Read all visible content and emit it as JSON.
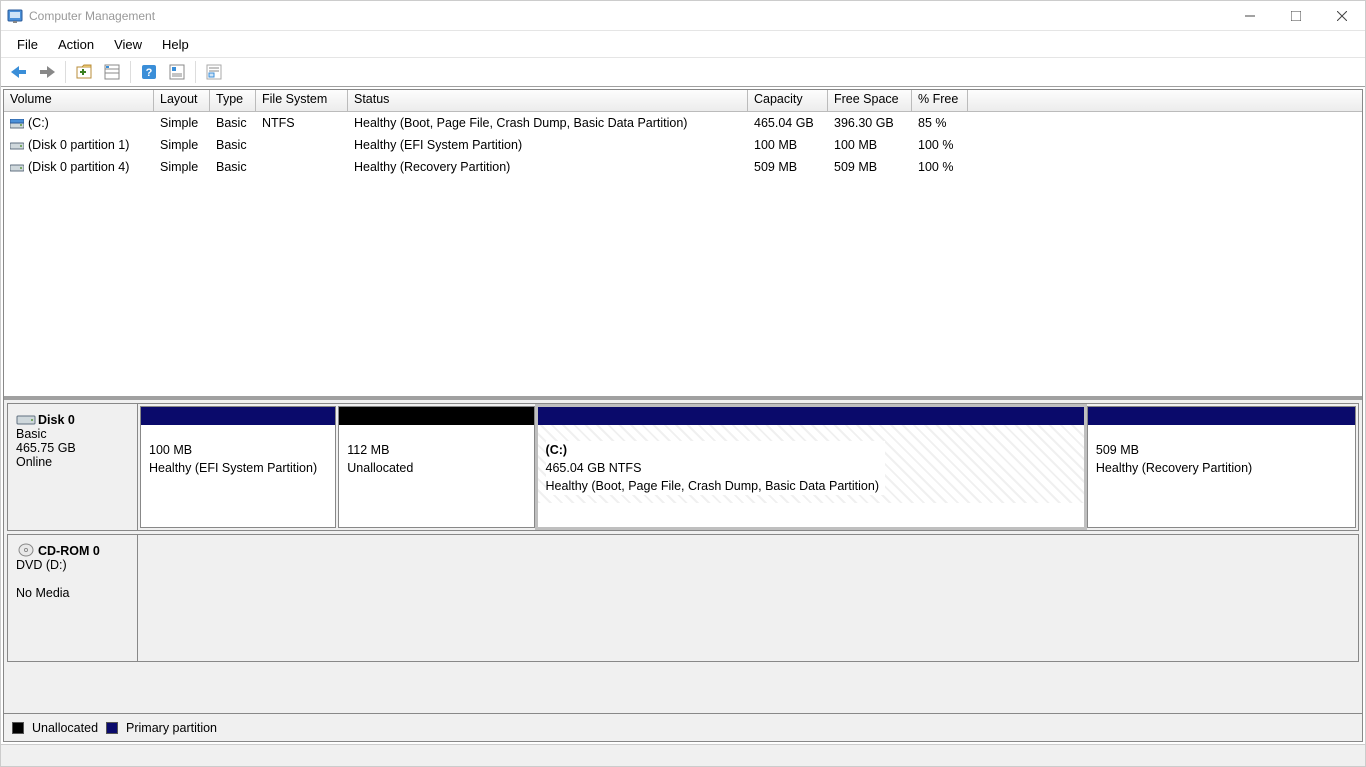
{
  "window": {
    "title": "Computer Management"
  },
  "menu": {
    "file": "File",
    "action": "Action",
    "view": "View",
    "help": "Help"
  },
  "vlist": {
    "headers": {
      "volume": "Volume",
      "layout": "Layout",
      "type": "Type",
      "fs": "File System",
      "status": "Status",
      "capacity": "Capacity",
      "free": "Free Space",
      "pct": "% Free"
    },
    "rows": [
      {
        "volume": "(C:)",
        "layout": "Simple",
        "type": "Basic",
        "fs": "NTFS",
        "status": "Healthy (Boot, Page File, Crash Dump, Basic Data Partition)",
        "capacity": "465.04 GB",
        "free": "396.30 GB",
        "pct": "85 %",
        "icon": "drive"
      },
      {
        "volume": "(Disk 0 partition 1)",
        "layout": "Simple",
        "type": "Basic",
        "fs": "",
        "status": "Healthy (EFI System Partition)",
        "capacity": "100 MB",
        "free": "100 MB",
        "pct": "100 %",
        "icon": "part"
      },
      {
        "volume": "(Disk 0 partition 4)",
        "layout": "Simple",
        "type": "Basic",
        "fs": "",
        "status": "Healthy (Recovery Partition)",
        "capacity": "509 MB",
        "free": "509 MB",
        "pct": "100 %",
        "icon": "part"
      }
    ]
  },
  "disks": [
    {
      "title": "Disk 0",
      "type": "Basic",
      "size": "465.75 GB",
      "state": "Online",
      "kind": "disk",
      "parts": [
        {
          "name": "",
          "line1": "100 MB",
          "line2": "Healthy (EFI System Partition)",
          "kind": "primary",
          "flex": 16,
          "selected": false
        },
        {
          "name": "",
          "line1": "112 MB",
          "line2": "Unallocated",
          "kind": "unalloc",
          "flex": 16,
          "selected": false
        },
        {
          "name": "(C:)",
          "line1": "465.04 GB NTFS",
          "line2": "Healthy (Boot, Page File, Crash Dump, Basic Data Partition)",
          "kind": "primary",
          "flex": 45,
          "selected": true
        },
        {
          "name": "",
          "line1": "509 MB",
          "line2": "Healthy (Recovery Partition)",
          "kind": "primary",
          "flex": 22,
          "selected": false
        }
      ]
    },
    {
      "title": "CD-ROM 0",
      "type": "DVD (D:)",
      "size": "",
      "state": "No Media",
      "kind": "cd",
      "parts": []
    }
  ],
  "legend": {
    "unalloc": "Unallocated",
    "primary": "Primary partition"
  }
}
